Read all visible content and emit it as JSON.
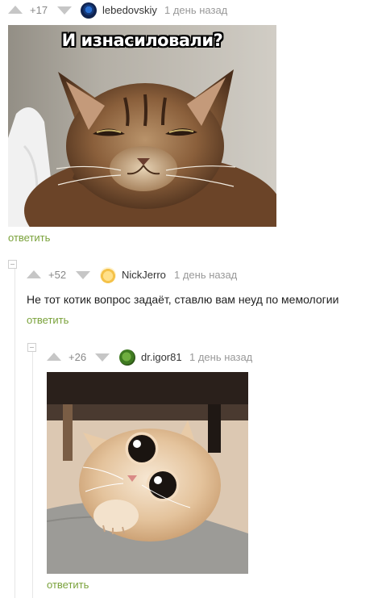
{
  "comments": [
    {
      "rating": "+17",
      "username": "lebedovskiy",
      "time": "1 день назад",
      "avatar_icon": "peacock-feather-avatar",
      "image_caption": "И изнасиловали?",
      "reply_label": "ответить"
    },
    {
      "rating": "+52",
      "username": "NickJerro",
      "time": "1 день назад",
      "avatar_icon": "cartoon-avatar",
      "text": "Не тот котик вопрос задаёт, ставлю вам неуд по мемологии",
      "reply_label": "ответить"
    },
    {
      "rating": "+26",
      "username": "dr.igor81",
      "time": "1 день назад",
      "avatar_icon": "green-bird-avatar",
      "reply_label": "ответить"
    }
  ],
  "colors": {
    "reply_link": "#7aa23b",
    "vote_arrow": "#c6c6c6",
    "text": "#222222"
  }
}
